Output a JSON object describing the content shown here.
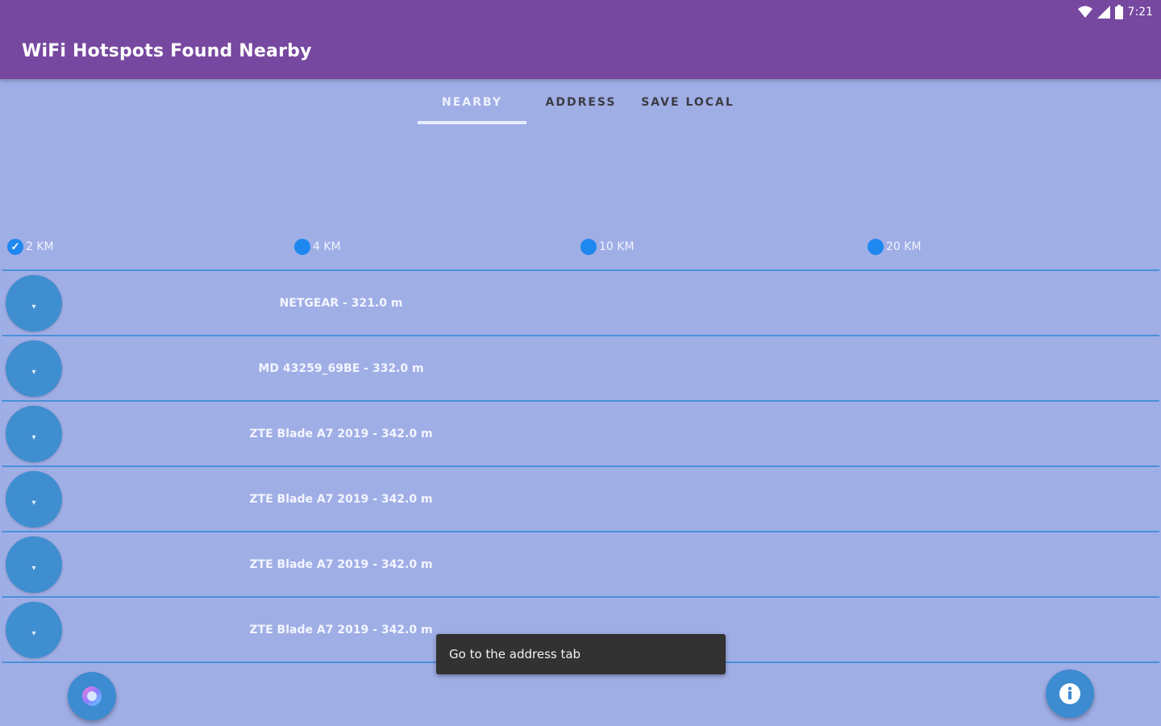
{
  "status_bar": {
    "time": "7:21",
    "icons": [
      "wifi-icon",
      "signal-icon",
      "battery-icon"
    ]
  },
  "app_bar": {
    "title": "WiFi Hotspots Found Nearby"
  },
  "tabs": [
    {
      "label": "Nearby",
      "active": true
    },
    {
      "label": "Address",
      "active": false
    },
    {
      "label": "Save Local",
      "active": false
    }
  ],
  "radius_options": [
    {
      "label": "2 KM",
      "selected": true
    },
    {
      "label": "4 KM",
      "selected": false
    },
    {
      "label": "10 KM",
      "selected": false
    },
    {
      "label": "20 KM",
      "selected": false
    }
  ],
  "hotspots": [
    {
      "text": "NETGEAR - 321.0 m"
    },
    {
      "text": "MD 43259_69BE - 332.0 m"
    },
    {
      "text": "ZTE Blade A7 2019 - 342.0 m"
    },
    {
      "text": "ZTE Blade A7 2019 - 342.0 m"
    },
    {
      "text": "ZTE Blade A7 2019 - 342.0 m"
    },
    {
      "text": "ZTE Blade A7 2019 - 342.0 m"
    }
  ],
  "toast": {
    "message": "Go to the address tab"
  },
  "fabs": {
    "left_icon": "colorful-circle-icon",
    "right_icon": "info-icon"
  },
  "colors": {
    "app_bar": "#7748a0",
    "background": "#a0aee6",
    "accent": "#1e88f0",
    "fab": "#3d8bd0"
  }
}
